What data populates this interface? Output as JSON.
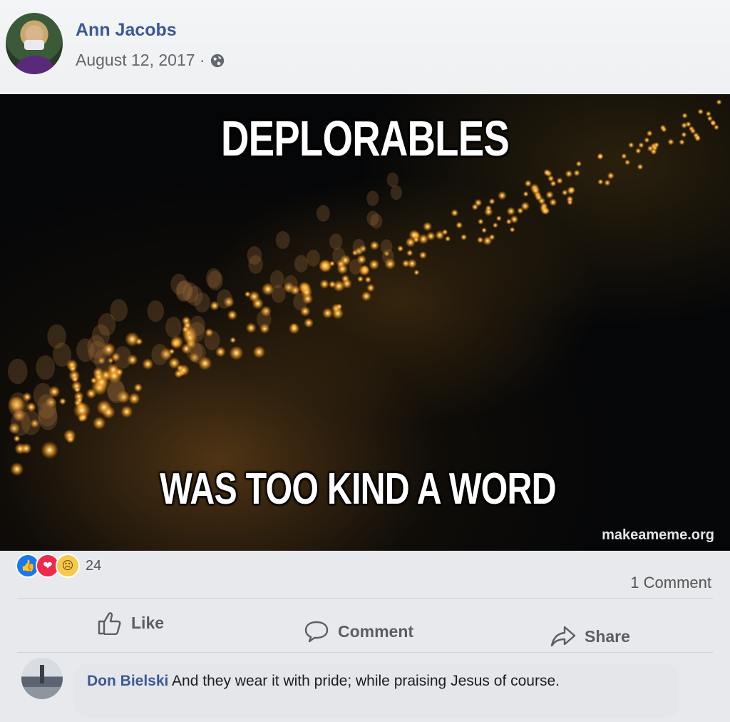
{
  "post": {
    "author": "Ann Jacobs",
    "date": "August 12, 2017 ·",
    "privacy_icon": "globe-icon"
  },
  "meme": {
    "top_text": "DEPLORABLES",
    "bottom_text": "WAS TOO KIND A WORD",
    "watermark": "makeameme.org"
  },
  "reactions": {
    "icons": [
      "like-reaction-icon",
      "love-reaction-icon",
      "sad-reaction-icon"
    ],
    "count": "24",
    "comments": "1 Comment"
  },
  "actions": {
    "like": "Like",
    "comment": "Comment",
    "share": "Share"
  },
  "comment": {
    "author": "Don Bielski",
    "text": " And they wear it with pride; while praising Jesus of course."
  },
  "colors": {
    "author_link": "#3b5998",
    "like_blue": "#1877f2",
    "love_red": "#f0284a",
    "sad_yellow": "#f7c84a"
  }
}
